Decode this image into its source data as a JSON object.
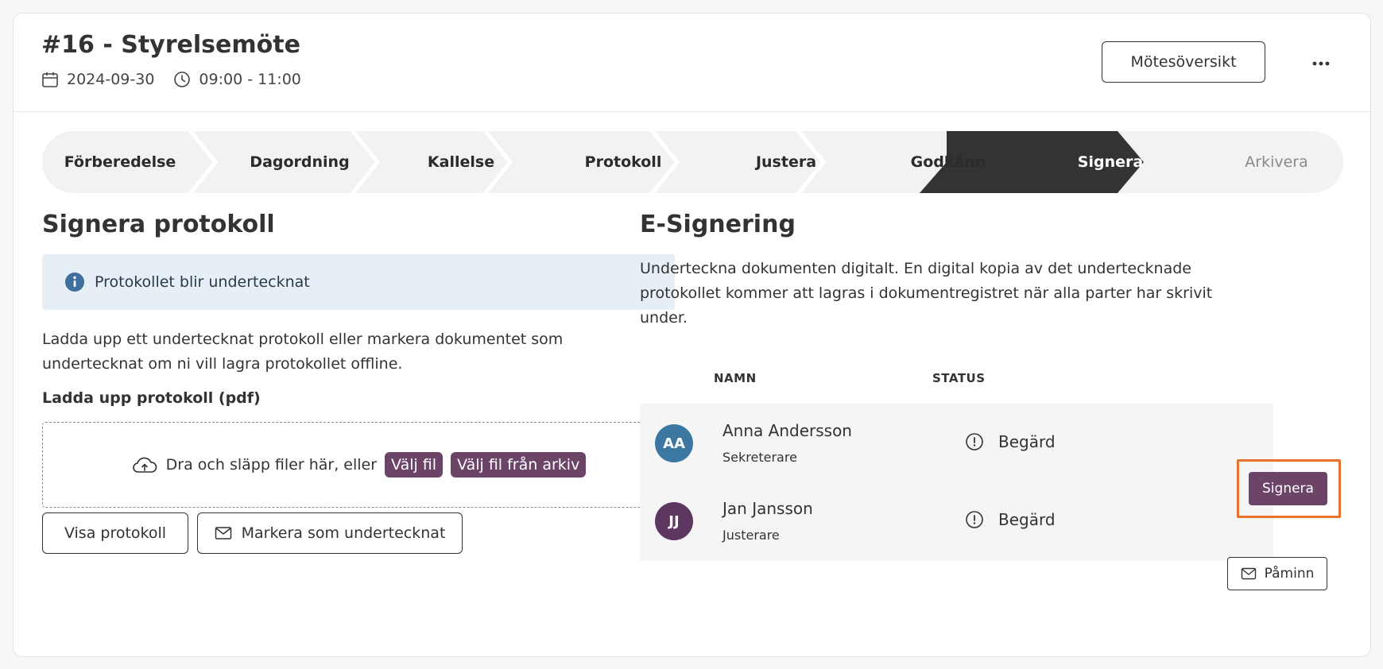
{
  "header": {
    "title": "#16 - Styrelsemöte",
    "date": "2024-09-30",
    "time": "09:00 - 11:00",
    "overview_label": "Mötesöversikt",
    "more_label": "···"
  },
  "steps": [
    {
      "label": "Förberedelse",
      "state": "done"
    },
    {
      "label": "Dagordning",
      "state": "done"
    },
    {
      "label": "Kallelse",
      "state": "done"
    },
    {
      "label": "Protokoll",
      "state": "done"
    },
    {
      "label": "Justera",
      "state": "done"
    },
    {
      "label": "Godkänn",
      "state": "done"
    },
    {
      "label": "Signera",
      "state": "active"
    },
    {
      "label": "Arkivera",
      "state": "future"
    }
  ],
  "left": {
    "heading": "Signera protokoll",
    "info_text": "Protokollet blir undertecknat",
    "description_line1": "Ladda upp ett undertecknat protokoll eller markera dokumentet som",
    "description_line2": "undertecknat om ni vill lagra protokollet offline.",
    "upload_label": "Ladda upp protokoll (pdf)",
    "dropzone_text": "Dra och släpp filer här, eller",
    "choose_file": "Välj fil",
    "choose_from_archive": "Välj fil från arkiv",
    "view_button": "Visa protokoll",
    "mark_signed_button": "Markera som undertecknat"
  },
  "right": {
    "heading": "E-Signering",
    "description_line1": "Underteckna dokumenten digitalt. En digital kopia av det undertecknade",
    "description_line2": "protokollet kommer att lagras i dokumentregistret när alla parter har skrivit",
    "description_line3": "under.",
    "col_name": "NAMN",
    "col_status": "STATUS",
    "signers": [
      {
        "initials": "AA",
        "name": "Anna Andersson",
        "role": "Sekreterare",
        "status": "Begärd",
        "action": "Signera",
        "avatar_color": "#3b77a0"
      },
      {
        "initials": "JJ",
        "name": "Jan Jansson",
        "role": "Justerare",
        "status": "Begärd",
        "action": "Påminn",
        "avatar_color": "#5e3760"
      }
    ]
  },
  "colors": {
    "accent_purple": "#6b4468",
    "active_step": "#333333",
    "focus_orange": "#e8732e",
    "info_bg": "#e6eef6",
    "info_icon": "#3f6f9f"
  }
}
